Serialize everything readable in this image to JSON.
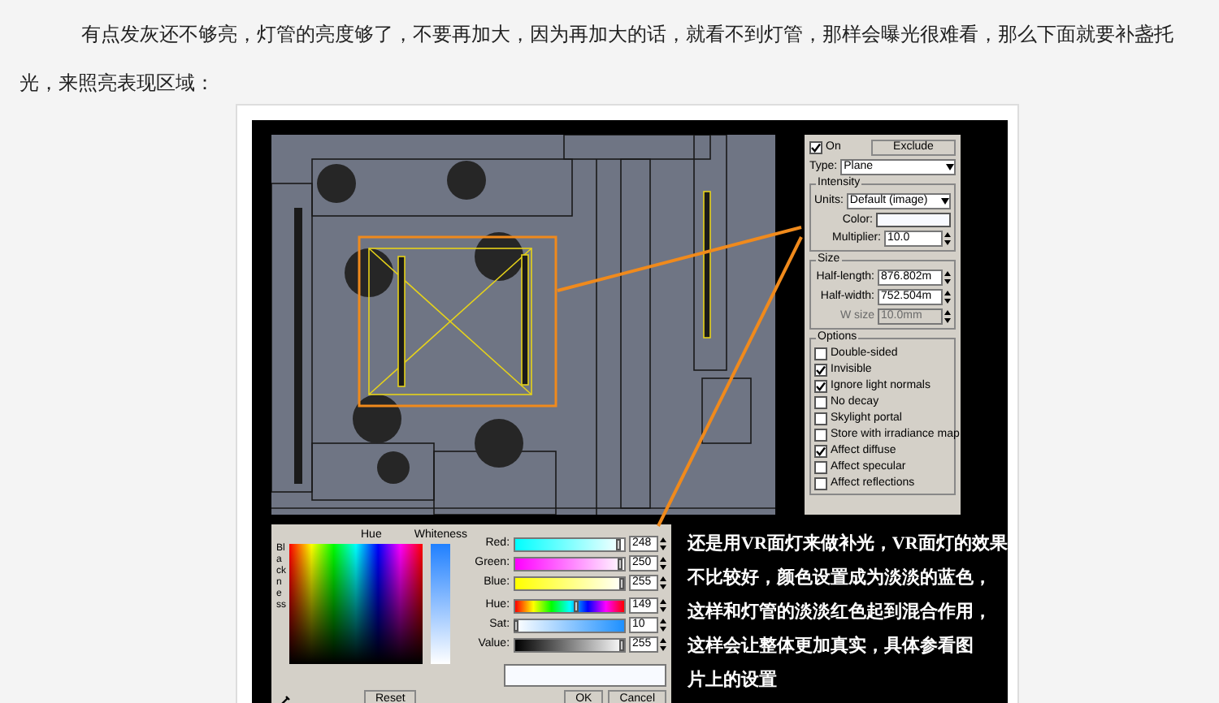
{
  "article": {
    "paragraph": "有点发灰还不够亮，灯管的亮度够了，不要再加大，因为再加大的话，就看不到灯管，那样会曝光很难看，那么下面就要补盏托光，来照亮表现区域："
  },
  "figure": {
    "light_panel": {
      "on": {
        "label": "On",
        "checked": true
      },
      "exclude_button": "Exclude",
      "type_label": "Type:",
      "type_value": "Plane",
      "intensity": {
        "title": "Intensity",
        "units_label": "Units:",
        "units_value": "Default (image)",
        "color_label": "Color:",
        "color": "#f8faff",
        "multiplier_label": "Multiplier:",
        "multiplier_value": "10.0"
      },
      "size": {
        "title": "Size",
        "fields": [
          {
            "label": "Half-length:",
            "value": "876.802m",
            "disabled": false
          },
          {
            "label": "Half-width:",
            "value": "752.504m",
            "disabled": false
          },
          {
            "label": "W size",
            "value": "10.0mm",
            "disabled": true
          }
        ]
      },
      "options": {
        "title": "Options",
        "items": [
          {
            "label": "Double-sided",
            "checked": false
          },
          {
            "label": "Invisible",
            "checked": true
          },
          {
            "label": "Ignore light normals",
            "checked": true
          },
          {
            "label": "No decay",
            "checked": false
          },
          {
            "label": "Skylight portal",
            "checked": false
          },
          {
            "label": "Store with irradiance map",
            "checked": false
          },
          {
            "label": "Affect diffuse",
            "checked": true
          },
          {
            "label": "Affect specular",
            "checked": false
          },
          {
            "label": "Affect reflections",
            "checked": false
          }
        ]
      }
    },
    "color_picker": {
      "hue_label": "Hue",
      "whiteness_label": "Whiteness",
      "blackness_label": "Blackness",
      "channels": [
        {
          "kind": "red",
          "label": "Red:",
          "value": "248",
          "level": 0.97
        },
        {
          "kind": "green",
          "label": "Green:",
          "value": "250",
          "level": 0.98
        },
        {
          "kind": "blue",
          "label": "Blue:",
          "value": "255",
          "level": 1
        },
        {
          "kind": "hue",
          "label": "Hue:",
          "value": "149",
          "level": 0.58
        },
        {
          "kind": "sat",
          "label": "Sat:",
          "value": "10",
          "level": 0.04
        },
        {
          "kind": "value",
          "label": "Value:",
          "value": "255",
          "level": 1
        }
      ],
      "buttons": [
        "Reset",
        "OK",
        "Cancel"
      ]
    },
    "caption_lines": [
      "还是用VR面灯来做补光，VR面灯的效果",
      "不比较好，颜色设置成为淡淡的蓝色，",
      "这样和灯管的淡淡红色起到混合作用，",
      "这样会让整体更加真实，具体参看图",
      "片上的设置"
    ]
  }
}
